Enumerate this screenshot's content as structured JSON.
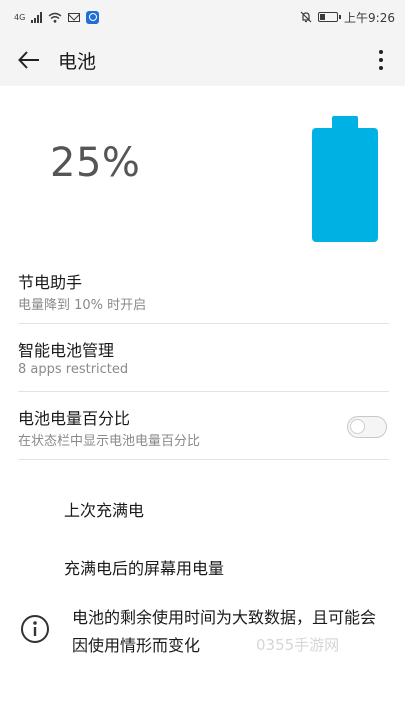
{
  "status_bar": {
    "carrier_tag": "4G",
    "time": "上午9:26"
  },
  "app_bar": {
    "title": "电池"
  },
  "battery": {
    "percent_label": "25%",
    "level": 0.25,
    "color": "#00b1e3"
  },
  "settings": [
    {
      "title": "节电助手",
      "subtitle": "电量降到 10% 时开启"
    },
    {
      "title": "智能电池管理",
      "subtitle": "8 apps restricted"
    },
    {
      "title": "电池电量百分比",
      "subtitle": "在状态栏中显示电池电量百分比",
      "toggle_on": false
    }
  ],
  "links": {
    "last_full_charge": "上次充满电",
    "screen_usage_since_full": "充满电后的屏幕用电量"
  },
  "info": {
    "text": "电池的剩余使用时间为大致数据，且可能会因使用情形而变化"
  },
  "watermark": "0355手游网"
}
